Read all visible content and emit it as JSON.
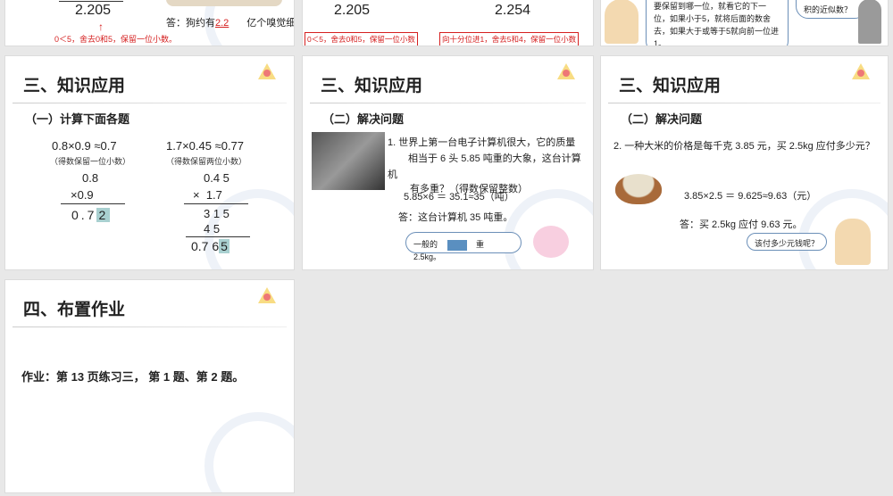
{
  "slides": [
    {
      "calc": "2.205",
      "answer_prefix": "答：狗约有",
      "answer_value": "2.2",
      "answer_suffix": "亿个嗅觉细",
      "note": "0＜5，舍去0和5，保留一位小数。"
    },
    {
      "calc_left": "2.205",
      "calc_right": "2.254",
      "note_left": "0＜5，舍去0和5，保留一位小数",
      "note_right": "向十分位进1，舍去5和4，保留一位小数"
    },
    {
      "bubble_left": "要保留到哪一位，就看它的下一位，如果小于5，就将后面的数舍去，如果大于或等于5就向前一位进1。",
      "bubble_right": "积的近似数？"
    },
    {
      "title": "三、知识应用",
      "subtitle": "（一）计算下面各题",
      "p1": {
        "expr": "0.8×0.9 ≈0.7",
        "hint": "（得数保留一位小数）",
        "a": "0.8",
        "b": "×0.9",
        "r_main": "0.7",
        "r_hl": "2"
      },
      "p2": {
        "expr": "1.7×0.45 ≈0.77",
        "hint": "（得数保留两位小数）",
        "a": "0.4 5",
        "b": "×  1.7",
        "s1": "3 1 5",
        "s2": "4 5",
        "r_main": "0.7 6",
        "r_hl": "5"
      }
    },
    {
      "title": "三、知识应用",
      "subtitle": "（二）解决问题",
      "q1": "1. 世界上第一台电子计算机很大，它的质量",
      "q2": "相当于 6 头 5.85 吨重的大象，这台计算",
      "q3": "机",
      "q4": "有多重？（得数保留整数）",
      "calc": "5.85×6 ＝ 35.1≈35（吨）",
      "answer": "答：这台计算机 35 吨重。",
      "bubble_a": "一般的",
      "bubble_b": "重 2.5kg。"
    },
    {
      "title": "三、知识应用",
      "subtitle": "（二）解决问题",
      "question": "2. 一种大米的价格是每千克 3.85 元，买 2.5kg 应付多少元？",
      "calc": "3.85×2.5 ＝ 9.625≈9.63（元）",
      "answer": "答：买 2.5kg 应付 9.63 元。",
      "bubble": "该付多少元钱呢？"
    },
    {
      "title": "四、布置作业",
      "homework": "作业：第 13 页练习三， 第 1 题、第 2 题。"
    }
  ],
  "colors": {
    "accent_red": "#d52020",
    "highlight": "#a9d0d0",
    "background": "#e8e8e8"
  }
}
